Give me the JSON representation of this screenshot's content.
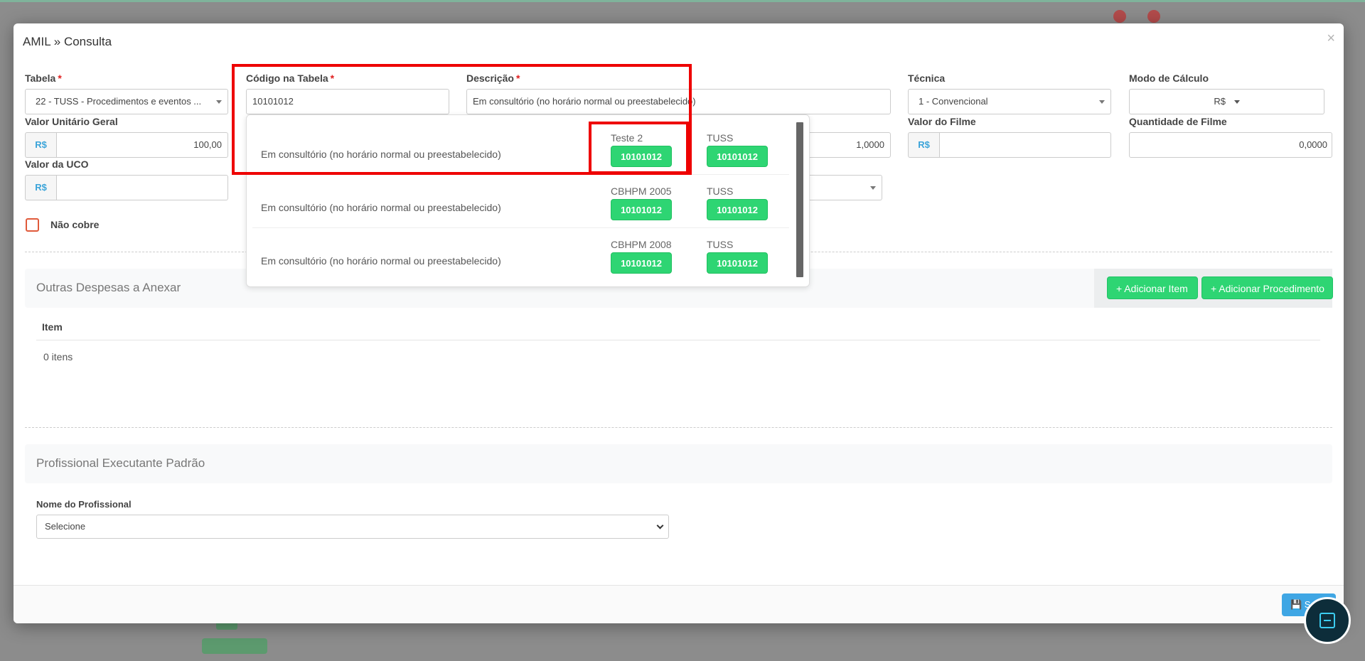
{
  "modal": {
    "title": "AMIL » Consulta",
    "close_label": "×"
  },
  "form": {
    "tabela": {
      "label": "Tabela",
      "value": "22 - TUSS - Procedimentos e eventos ..."
    },
    "codigo": {
      "label": "Código na Tabela",
      "value": "10101012"
    },
    "descricao": {
      "label": "Descrição",
      "value": "Em consultório (no horário normal ou preestabelecido)"
    },
    "tecnica": {
      "label": "Técnica",
      "value": "1 - Convencional"
    },
    "modo_calculo": {
      "label": "Modo de Cálculo",
      "value": "R$"
    },
    "valor_unitario": {
      "label": "Valor Unitário Geral",
      "prefix": "R$",
      "value": "100,00"
    },
    "fator": {
      "value": "1,0000"
    },
    "valor_filme": {
      "label": "Valor do Filme",
      "prefix": "R$",
      "value": ""
    },
    "quantidade_filme": {
      "label": "Quantidade de Filme",
      "value": "0,0000"
    },
    "valor_uco": {
      "label": "Valor da UCO",
      "prefix": "R$",
      "value": ""
    },
    "nao_cobre": {
      "label": "Não cobre",
      "checked": false
    }
  },
  "autocomplete": {
    "rows": [
      {
        "description": "Em consultório (no horário normal ou preestabelecido)",
        "table1": "Teste 2",
        "code1": "10101012",
        "table2": "TUSS",
        "code2": "10101012"
      },
      {
        "description": "Em consultório (no horário normal ou preestabelecido)",
        "table1": "CBHPM 2005",
        "code1": "10101012",
        "table2": "TUSS",
        "code2": "10101012"
      },
      {
        "description": "Em consultório (no horário normal ou preestabelecido)",
        "table1": "CBHPM 2008",
        "code1": "10101012",
        "table2": "TUSS",
        "code2": "10101012"
      }
    ]
  },
  "outras_despesas": {
    "title": "Outras Despesas a Anexar",
    "add_item_label": "+ Adicionar Item",
    "add_procedimento_label": "+ Adicionar Procedimento",
    "column_item": "Item",
    "count_text": "0 itens"
  },
  "profissional": {
    "title": "Profissional Executante Padrão",
    "nome_label": "Nome do Profissional",
    "nome_value": "Selecione"
  },
  "footer": {
    "save_label": "💾 Salvar"
  },
  "colors": {
    "green": "#2ed573",
    "blue": "#3fa6e4",
    "highlight": "#ee0000",
    "required": "#e02020"
  }
}
